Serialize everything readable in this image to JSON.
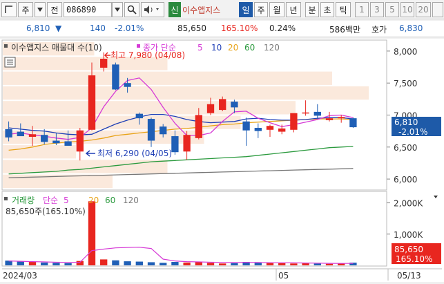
{
  "toolbar": {
    "item1": "주",
    "item2": "전",
    "code": "086890",
    "sin": "신",
    "title": "이수앱지스",
    "periods": [
      "일",
      "주",
      "월",
      "년",
      "분",
      "초",
      "틱"
    ],
    "nums": [
      "1",
      "3",
      "5",
      "10",
      "20"
    ]
  },
  "info": {
    "price": "6,810",
    "price_arrow": "▼",
    "change": "140",
    "change_pct": "-2.01%",
    "volume": "85,650",
    "vol_ratio": "165.10%",
    "turnover": "0.24%",
    "amount": "586백만",
    "quote_label": "호가",
    "quote": "6,830"
  },
  "legend": {
    "title": "이수앱지스 매물대 수(10)",
    "ma_label": "종가 단순",
    "ma_periods": [
      "5",
      "10",
      "20",
      "60",
      "120"
    ],
    "high_label": "최고 7,980 (04/08)",
    "low_label": "최저 6,290 (04/05)",
    "vol_label": "거래량",
    "vol_ma_label": "단순",
    "vol_ma_periods": [
      "5",
      "20",
      "60",
      "120"
    ],
    "vol_value": "85,650주(165.10%)"
  },
  "colors": {
    "up": "#e8261f",
    "down": "#1f5fb6",
    "ma5": "#d63ad6",
    "ma10": "#1f3fb6",
    "ma20": "#e8a317",
    "ma60": "#2b9a3e",
    "ma120": "#777777",
    "price_tag": "#1e5aa8",
    "vol_tag": "#e8261f"
  },
  "price_axis": {
    "ticks": [
      "8,000",
      "7,500",
      "7,000",
      "6,500",
      "6,000"
    ],
    "current": "6,810",
    "current_pct": "-2.01%"
  },
  "volume_axis": {
    "ticks": [
      "2,000K",
      "1,000K"
    ],
    "current": "85,650",
    "current_pct": "165.10%"
  },
  "date_axis": {
    "labels": [
      "2024/03",
      "05",
      "05/13"
    ]
  },
  "chart_data": {
    "type": "candlestick",
    "ylim": [
      5850,
      8150
    ],
    "candles": [
      {
        "o": 6780,
        "h": 6900,
        "l": 6590,
        "c": 6650
      },
      {
        "o": 6740,
        "h": 6870,
        "l": 6680,
        "c": 6670
      },
      {
        "o": 6660,
        "h": 6830,
        "l": 6520,
        "c": 6700
      },
      {
        "o": 6690,
        "h": 6780,
        "l": 6540,
        "c": 6580
      },
      {
        "o": 6600,
        "h": 6720,
        "l": 6530,
        "c": 6560
      },
      {
        "o": 6590,
        "h": 6760,
        "l": 6560,
        "c": 6520
      },
      {
        "o": 6430,
        "h": 6800,
        "l": 6290,
        "c": 6760
      },
      {
        "o": 6770,
        "h": 7820,
        "l": 6760,
        "c": 7620
      },
      {
        "o": 7740,
        "h": 7980,
        "l": 7680,
        "c": 7880
      },
      {
        "o": 7790,
        "h": 7820,
        "l": 7390,
        "c": 7400
      },
      {
        "o": 7500,
        "h": 7580,
        "l": 7350,
        "c": 7440
      },
      {
        "o": 7020,
        "h": 7040,
        "l": 6850,
        "c": 6950
      },
      {
        "o": 6940,
        "h": 6960,
        "l": 6500,
        "c": 6600
      },
      {
        "o": 6820,
        "h": 6860,
        "l": 6650,
        "c": 6700
      },
      {
        "o": 6670,
        "h": 6760,
        "l": 6380,
        "c": 6420
      },
      {
        "o": 6430,
        "h": 6750,
        "l": 6300,
        "c": 6690
      },
      {
        "o": 6640,
        "h": 7110,
        "l": 6620,
        "c": 7000
      },
      {
        "o": 7030,
        "h": 7270,
        "l": 7000,
        "c": 7170
      },
      {
        "o": 7080,
        "h": 7290,
        "l": 7060,
        "c": 7250
      },
      {
        "o": 7210,
        "h": 7240,
        "l": 7030,
        "c": 7120
      },
      {
        "o": 6900,
        "h": 6960,
        "l": 6520,
        "c": 6760
      },
      {
        "o": 6800,
        "h": 6870,
        "l": 6640,
        "c": 6750
      },
      {
        "o": 6770,
        "h": 6850,
        "l": 6660,
        "c": 6830
      },
      {
        "o": 6740,
        "h": 6850,
        "l": 6700,
        "c": 6790
      },
      {
        "o": 6770,
        "h": 6990,
        "l": 6730,
        "c": 7030
      },
      {
        "o": 7030,
        "h": 7230,
        "l": 6990,
        "c": 7040
      },
      {
        "o": 7050,
        "h": 7170,
        "l": 6940,
        "c": 6990
      },
      {
        "o": 6920,
        "h": 7050,
        "l": 6900,
        "c": 6950
      },
      {
        "o": 6950,
        "h": 7000,
        "l": 6880,
        "c": 6970
      },
      {
        "o": 6950,
        "h": 6960,
        "l": 6800,
        "c": 6810
      }
    ],
    "volume_ylim": [
      0,
      2300
    ],
    "volume": [
      150,
      120,
      110,
      90,
      80,
      70,
      140,
      2050,
      190,
      160,
      130,
      120,
      100,
      80,
      110,
      90,
      100,
      80,
      60,
      70,
      110,
      90,
      80,
      70,
      60,
      70,
      60,
      50,
      55,
      85.65
    ],
    "ma5_vol": [
      140,
      130,
      120,
      110,
      100,
      95,
      100,
      470,
      520,
      560,
      570,
      580,
      540,
      200,
      140,
      120,
      110,
      100,
      95,
      90,
      95,
      90,
      85,
      80,
      80,
      75,
      70,
      65,
      62,
      62
    ],
    "ma5": [
      6700,
      6720,
      6690,
      6670,
      6640,
      6620,
      6650,
      6800,
      7130,
      7370,
      7540,
      7580,
      7400,
      7120,
      6870,
      6680,
      6680,
      6720,
      6900,
      7050,
      7060,
      6950,
      6880,
      6820,
      6850,
      6890,
      6930,
      6990,
      7000,
      6960
    ],
    "ma10": [
      6800,
      6780,
      6760,
      6750,
      6720,
      6700,
      6690,
      6700,
      6780,
      6860,
      6920,
      6970,
      7010,
      7010,
      6980,
      6930,
      6900,
      6880,
      6890,
      6900,
      6940,
      6950,
      6930,
      6920,
      6920,
      6930,
      6950,
      6960,
      6960,
      6940
    ],
    "ma20": [
      6450,
      6470,
      6500,
      6540,
      6560,
      6580,
      6590,
      6610,
      6640,
      6680,
      6700,
      6720,
      6740,
      6760,
      6780,
      6790,
      6810,
      6830,
      6850,
      6860,
      6880,
      6890,
      6900,
      6910,
      6920,
      6930,
      6940,
      6940,
      6940,
      6930
    ],
    "ma60": [
      6080,
      6090,
      6100,
      6110,
      6120,
      6140,
      6150,
      6170,
      6190,
      6210,
      6230,
      6250,
      6270,
      6280,
      6290,
      6300,
      6310,
      6320,
      6330,
      6340,
      6350,
      6370,
      6390,
      6410,
      6430,
      6450,
      6470,
      6490,
      6500,
      6510
    ],
    "ma120": [
      6020,
      6025,
      6030,
      6035,
      6040,
      6045,
      6050,
      6055,
      6060,
      6065,
      6070,
      6075,
      6080,
      6085,
      6090,
      6095,
      6100,
      6105,
      6110,
      6115,
      6120,
      6125,
      6130,
      6135,
      6140,
      6145,
      6150,
      6155,
      6160,
      6165
    ],
    "volume_profile": [
      0.3,
      0.45,
      0.2,
      0.55,
      0.65,
      0.8,
      1.0,
      0.9,
      0.45,
      0.25
    ]
  }
}
